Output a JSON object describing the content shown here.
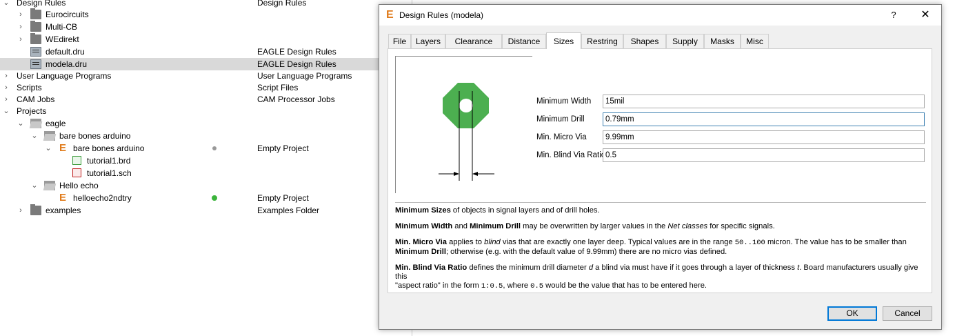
{
  "tree": {
    "rows": [
      {
        "name": "Design Rules",
        "desc": "Design Rules"
      },
      {
        "name": "Eurocircuits",
        "desc": ""
      },
      {
        "name": "Multi-CB",
        "desc": ""
      },
      {
        "name": "WEdirekt",
        "desc": ""
      },
      {
        "name": "default.dru",
        "desc": "EAGLE Design Rules"
      },
      {
        "name": "modela.dru",
        "desc": "EAGLE Design Rules"
      },
      {
        "name": "User Language Programs",
        "desc": "User Language Programs"
      },
      {
        "name": "Scripts",
        "desc": "Script Files"
      },
      {
        "name": "CAM Jobs",
        "desc": "CAM Processor Jobs"
      },
      {
        "name": "Projects",
        "desc": ""
      },
      {
        "name": "eagle",
        "desc": ""
      },
      {
        "name": "bare bones arduino",
        "desc": ""
      },
      {
        "name": "bare bones arduino",
        "desc": "Empty Project"
      },
      {
        "name": "tutorial1.brd",
        "desc": ""
      },
      {
        "name": "tutorial1.sch",
        "desc": ""
      },
      {
        "name": "Hello echo",
        "desc": ""
      },
      {
        "name": "helloecho2ndtry",
        "desc": "Empty Project"
      },
      {
        "name": "examples",
        "desc": "Examples Folder"
      }
    ],
    "status_colors": {
      "inactive": "#999999",
      "active": "#3cb43c"
    }
  },
  "dialog": {
    "title": "Design Rules (modela)",
    "help_label": "?",
    "close_label": "✕",
    "tabs": [
      "File",
      "Layers",
      "Clearance",
      "Distance",
      "Sizes",
      "Restring",
      "Shapes",
      "Supply",
      "Masks",
      "Misc"
    ],
    "active_tab": "Sizes",
    "fields": {
      "min_width": {
        "label": "Minimum Width",
        "value": "15mil"
      },
      "min_drill": {
        "label": "Minimum Drill",
        "value": "0.79mm"
      },
      "min_micro_via": {
        "label": "Min. Micro Via",
        "value": "9.99mm"
      },
      "min_blind_via_ratio": {
        "label": "Min. Blind Via Ratio",
        "value": "0.5"
      }
    },
    "help": {
      "p1_b1": "Minimum Sizes",
      "p1_t1": " of objects in signal layers and of drill holes.",
      "p2_b1": "Minimum Width",
      "p2_t1": " and ",
      "p2_b2": "Minimum Drill",
      "p2_t2": " may be overwritten by larger values in the ",
      "p2_i1": "Net classes",
      "p2_t3": " for specific signals.",
      "p3_b1": "Min. Micro Via",
      "p3_t1": " applies to ",
      "p3_i1": "blind",
      "p3_t2": " vias that are exactly one layer deep. Typical values are in the range ",
      "p3_m1": "50..100",
      "p3_t3": " micron. The value has to be smaller than",
      "p3_b2": "Minimum Drill",
      "p3_t4": "; otherwise (e.g. with the default value of 9.99mm) there are no micro vias defined.",
      "p4_b1": "Min. Blind Via Ratio",
      "p4_t1": " defines the minimum drill diameter ",
      "p4_i1": "d",
      "p4_t2": " a blind via must have if it goes through a layer of thickness ",
      "p4_i2": "t",
      "p4_t3": ". Board manufacturers usually give this",
      "p4_t4": "\"aspect ratio\" in the form ",
      "p4_m1": "1:0.5",
      "p4_t5": ", where ",
      "p4_m2": "0.5",
      "p4_t6": " would be the value that has to be entered here."
    },
    "ok_label": "OK",
    "cancel_label": "Cancel",
    "accent_color": "#0078d7",
    "pad_color": "#4caf50"
  }
}
